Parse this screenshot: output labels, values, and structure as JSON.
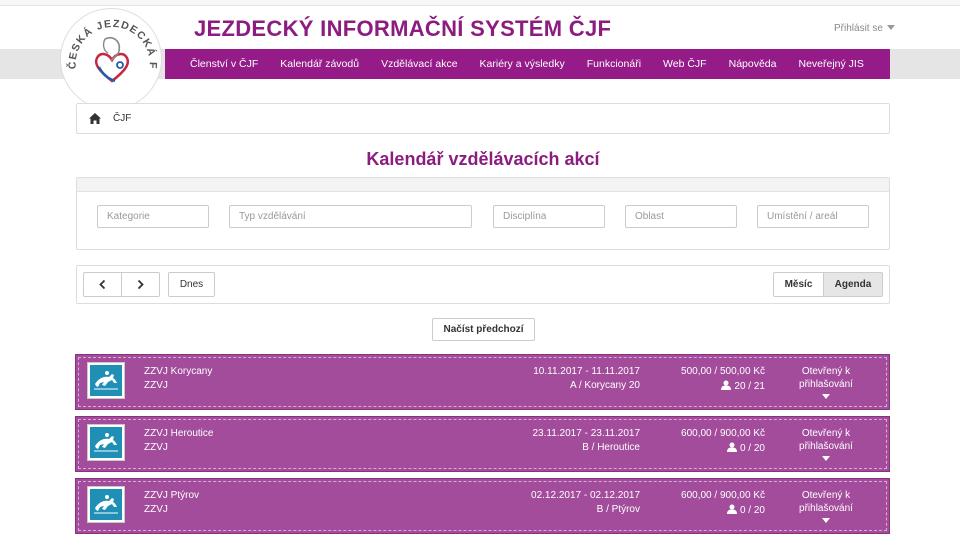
{
  "header": {
    "title": "JEZDECKÝ INFORMAČNÍ SYSTÉM ČJF",
    "login_label": "Přihlásit se",
    "logo_text_top": "ČESKÁ JEZDECKÁ FEDERACE"
  },
  "nav": {
    "items": [
      {
        "label": "Členství v ČJF"
      },
      {
        "label": "Kalendář závodů"
      },
      {
        "label": "Vzdělávací akce"
      },
      {
        "label": "Kariéry a výsledky"
      },
      {
        "label": "Funkcionáři"
      },
      {
        "label": "Web ČJF"
      },
      {
        "label": "Nápověda"
      },
      {
        "label": "Neveřejný JIS"
      }
    ]
  },
  "breadcrumb": {
    "items": [
      {
        "label": "ČJF"
      }
    ]
  },
  "page": {
    "heading": "Kalendář vzdělávacích akcí"
  },
  "filters": {
    "category": {
      "placeholder": "Kategorie",
      "value": ""
    },
    "type": {
      "placeholder": "Typ vzdělávání",
      "value": ""
    },
    "discipline": {
      "placeholder": "Disciplína",
      "value": ""
    },
    "region": {
      "placeholder": "Oblast",
      "value": ""
    },
    "venue": {
      "placeholder": "Umístění / areál",
      "value": ""
    }
  },
  "toolbar": {
    "prev_icon": "chevron-left-icon",
    "next_icon": "chevron-right-icon",
    "today_label": "Dnes",
    "month_label": "Měsíc",
    "agenda_label": "Agenda",
    "active_view": "Agenda"
  },
  "load_prev_label": "Načíst předchozí",
  "colors": {
    "brand": "#8c1d80",
    "nav_bg": "#951b89",
    "event_bg": "#a24c9b"
  },
  "events": [
    {
      "name": "ZZVJ Korycany",
      "category": "ZZVJ",
      "dates": "10.11.2017 - 11.11.2017",
      "location": "A / Korycany 20",
      "price": "500,00 / 500,00 Kč",
      "capacity": "20 / 21",
      "status_line1": "Otevřený k",
      "status_line2": "přihlašování",
      "icon": "horse-jumping-icon"
    },
    {
      "name": "ZZVJ Heroutice",
      "category": "ZZVJ",
      "dates": "23.11.2017 - 23.11.2017",
      "location": "B / Heroutice",
      "price": "600,00 / 900,00 Kč",
      "capacity": "0 / 20",
      "status_line1": "Otevřený k",
      "status_line2": "přihlašování",
      "icon": "horse-jumping-icon"
    },
    {
      "name": "ZZVJ Ptýrov",
      "category": "ZZVJ",
      "dates": "02.12.2017 - 02.12.2017",
      "location": "B / Ptýrov",
      "price": "600,00 / 900,00 Kč",
      "capacity": "0 / 20",
      "status_line1": "Otevřený k",
      "status_line2": "přihlašování",
      "icon": "horse-jumping-icon"
    }
  ]
}
